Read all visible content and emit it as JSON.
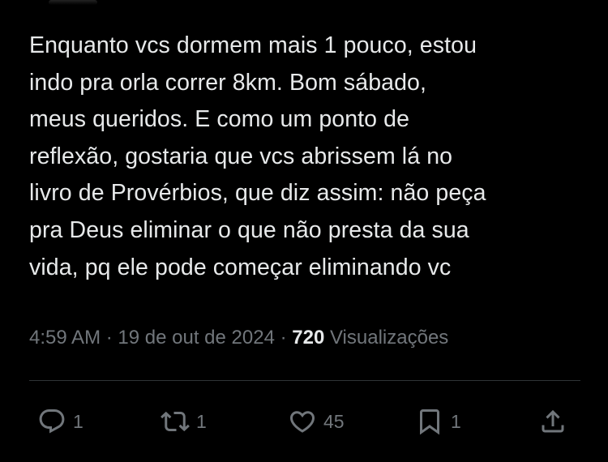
{
  "tweet": {
    "text_lines": [
      "Enquanto vcs dormem mais 1 pouco, estou",
      "indo pra orla correr 8km. Bom sábado,",
      "meus queridos. E como um ponto de",
      "reflexão, gostaria que vcs abrissem lá no",
      "livro de Provérbios, que diz assim: não peça",
      "pra Deus eliminar o que não presta da sua",
      "vida, pq ele pode começar eliminando vc"
    ],
    "time": "4:59 AM",
    "separator": "·",
    "date": "19 de out de 2024",
    "views_count": "720",
    "views_label": "Visualizações"
  },
  "actions": {
    "reply": {
      "icon": "reply-icon",
      "count": "1"
    },
    "retweet": {
      "icon": "retweet-icon",
      "count": "1"
    },
    "like": {
      "icon": "heart-icon",
      "count": "45"
    },
    "bookmark": {
      "icon": "bookmark-icon",
      "count": "1"
    },
    "share": {
      "icon": "share-icon"
    }
  },
  "colors": {
    "background": "#000000",
    "text": "#e7e9ea",
    "secondary": "#71767b",
    "divider": "#2f3336"
  }
}
